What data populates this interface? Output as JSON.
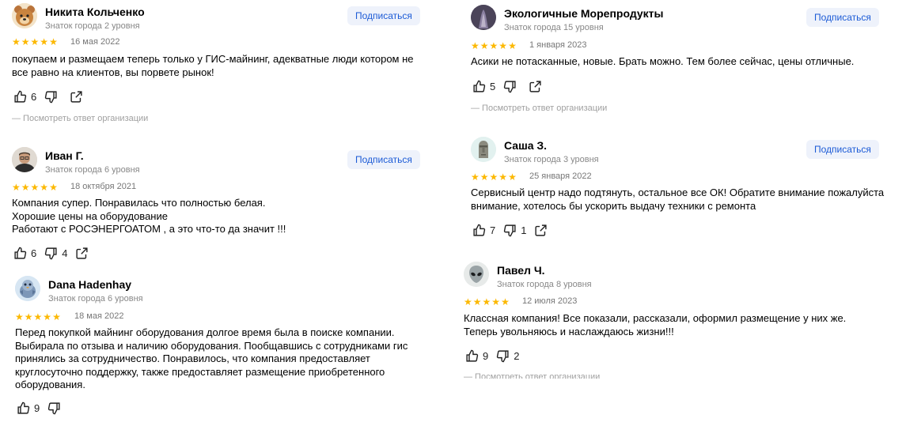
{
  "subscribe_label": "Подписаться",
  "reply_label": "— Посмотреть ответ организации",
  "colors": {
    "star": "#fcb800",
    "subscribe_bg": "#eef2fb",
    "subscribe_text": "#1c5bd6"
  },
  "reviews": [
    {
      "name": "Никита Кольченко",
      "level": "Знаток города 2 уровня",
      "date": "16 мая 2022",
      "lines": [
        "покупаем и размещаем теперь только у ГИС-майнинг, адекватные люди котором не",
        "все равно на клиентов, вы порвете рынок!"
      ],
      "likes": "6",
      "dislikes": "",
      "avatar_icon": "bear-emoji-icon"
    },
    {
      "name": "Иван Г.",
      "level": "Знаток города 6 уровня",
      "date": "18 октября 2021",
      "lines": [
        "Компания супер. Понравилась что полностью белая.",
        "Хорошие цены на оборудование",
        "Работают с РОСЭНЕРГОАТОМ , а это что-то да значит !!!"
      ],
      "likes": "6",
      "dislikes": "4",
      "avatar_icon": "user-photo-icon"
    },
    {
      "name": "Dana Hadenhay",
      "level": "Знаток города 6 уровня",
      "date": "18 мая 2022",
      "lines": [
        "Перед покупкой майнинг оборудования долгое время была в поиске компании.",
        "Выбирала по отзыва и наличию оборудования. Пообщавшись с сотрудниками гис",
        "принялись за сотрудничество. Понравилось, что компания предоставляет",
        "круглосуточно поддержку, также предоставляет размещение приобретенного",
        "оборудования."
      ],
      "likes": "9",
      "dislikes": "",
      "avatar_icon": "bird-avatar-icon"
    },
    {
      "name": "Экологичные Морепродукты",
      "level": "Знаток города 15 уровня",
      "date": "1 января 2023",
      "lines": [
        "Асики не потасканные, новые. Брать можно. Тем более сейчас, цены отличные."
      ],
      "likes": "5",
      "dislikes": "",
      "avatar_icon": "photo-avatar-icon"
    },
    {
      "name": "Саша З.",
      "level": "Знаток города 3 уровня",
      "date": "25 января 2022",
      "lines": [
        "Сервисный центр надо подтянуть, остальное все ОК! Обратите внимание пожалуйста",
        "внимание, хотелось бы ускорить выдачу техники с ремонта"
      ],
      "likes": "7",
      "dislikes": "1",
      "avatar_icon": "moai-emoji-icon"
    },
    {
      "name": "Павел Ч.",
      "level": "Знаток города 8 уровня",
      "date": "12 июля 2023",
      "lines": [
        "Классная компания! Все показали, рассказали, оформил размещение у них же.",
        "Теперь увольняюсь и наслаждаюсь жизни!!!"
      ],
      "likes": "9",
      "dislikes": "2",
      "avatar_icon": "alien-emoji-icon"
    }
  ]
}
